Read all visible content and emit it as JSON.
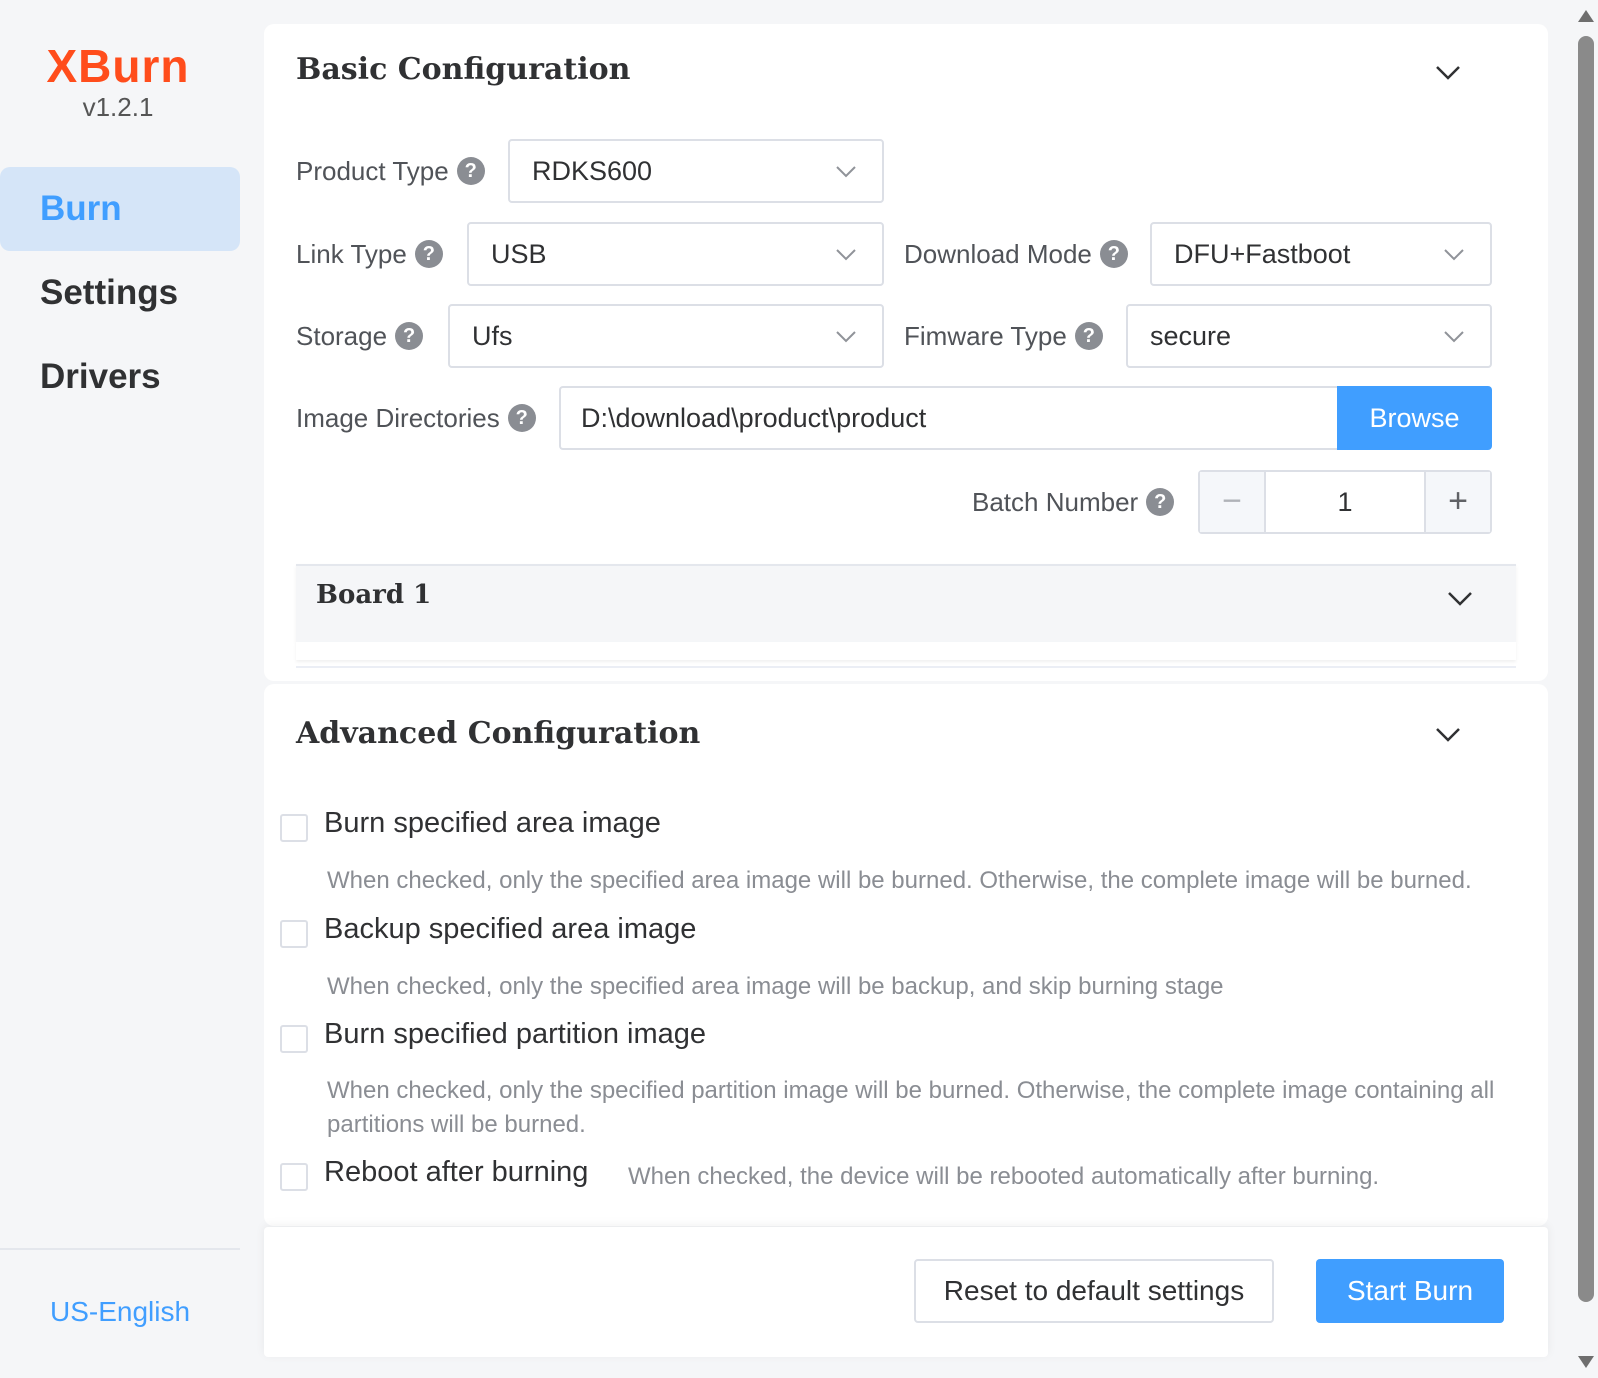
{
  "app": {
    "name": "XBurn",
    "version": "v1.2.1"
  },
  "sidebar": {
    "items": [
      {
        "label": "Burn",
        "active": true
      },
      {
        "label": "Settings",
        "active": false
      },
      {
        "label": "Drivers",
        "active": false
      }
    ],
    "language": "US-English"
  },
  "basic": {
    "title": "Basic Configuration",
    "product_type": {
      "label": "Product Type",
      "value": "RDKS600"
    },
    "link_type": {
      "label": "Link Type",
      "value": "USB"
    },
    "download_mode": {
      "label": "Download Mode",
      "value": "DFU+Fastboot"
    },
    "storage": {
      "label": "Storage",
      "value": "Ufs"
    },
    "firmware_type": {
      "label": "Fimware Type",
      "value": "secure"
    },
    "image_dir": {
      "label": "Image Directories",
      "value": "D:\\download\\product\\product",
      "browse": "Browse"
    },
    "batch_number": {
      "label": "Batch Number",
      "value": "1",
      "minus": "−",
      "plus": "+"
    },
    "board": {
      "title": "Board 1"
    },
    "help_glyph": "?"
  },
  "advanced": {
    "title": "Advanced Configuration",
    "options": [
      {
        "label": "Burn specified area image",
        "checked": false,
        "desc": "When checked, only the specified area image will be burned. Otherwise, the complete image will be burned."
      },
      {
        "label": "Backup specified area image",
        "checked": false,
        "desc": "When checked, only the specified area image will be backup, and skip burning stage"
      },
      {
        "label": "Burn specified partition image",
        "checked": false,
        "desc": "When checked, only the specified partition image will be burned. Otherwise, the complete image containing all partitions will be burned."
      },
      {
        "label": "Reboot after burning",
        "checked": false,
        "desc": "When checked, the device will be rebooted automatically after burning."
      }
    ]
  },
  "footer": {
    "reset_label": "Reset to default settings",
    "start_label": "Start Burn"
  },
  "colors": {
    "brand": "#ff4d1c",
    "primary": "#409eff",
    "active_nav_bg": "#d5e5f8"
  }
}
